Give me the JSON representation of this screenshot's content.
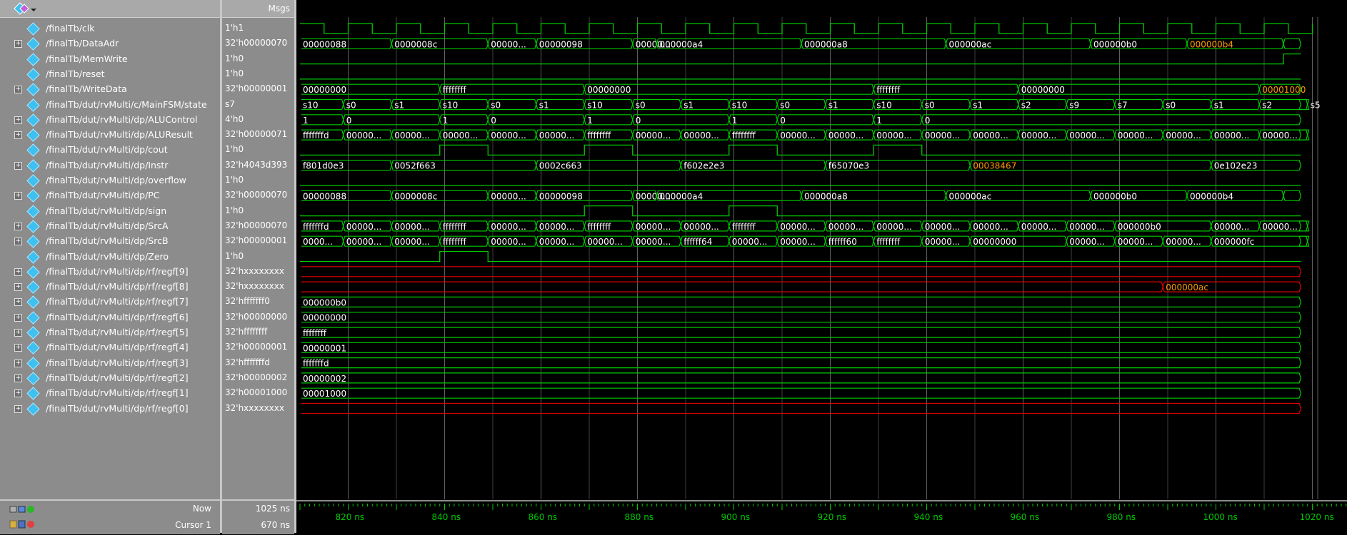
{
  "header": {
    "msgs_label": "Msgs"
  },
  "colors": {
    "wave": "#00c800",
    "invalid": "#e00000",
    "cursor": "#e0c000",
    "text_highlight": "#ff9900"
  },
  "signals": [
    {
      "name": "/finalTb/clk",
      "value": "1'h1",
      "expand": false
    },
    {
      "name": "/finalTb/DataAdr",
      "value": "32'h00000070",
      "expand": true
    },
    {
      "name": "/finalTb/MemWrite",
      "value": "1'h0",
      "expand": false
    },
    {
      "name": "/finalTb/reset",
      "value": "1'h0",
      "expand": false
    },
    {
      "name": "/finalTb/WriteData",
      "value": "32'h00000001",
      "expand": true
    },
    {
      "name": "/finalTb/dut/rvMulti/c/MainFSM/state",
      "value": "s7",
      "expand": false
    },
    {
      "name": "/finalTb/dut/rvMulti/dp/ALUControl",
      "value": "4'h0",
      "expand": true
    },
    {
      "name": "/finalTb/dut/rvMulti/dp/ALUResult",
      "value": "32'h00000071",
      "expand": true
    },
    {
      "name": "/finalTb/dut/rvMulti/dp/cout",
      "value": "1'h0",
      "expand": false
    },
    {
      "name": "/finalTb/dut/rvMulti/dp/Instr",
      "value": "32'h4043d393",
      "expand": true
    },
    {
      "name": "/finalTb/dut/rvMulti/dp/overflow",
      "value": "1'h0",
      "expand": false
    },
    {
      "name": "/finalTb/dut/rvMulti/dp/PC",
      "value": "32'h00000070",
      "expand": true
    },
    {
      "name": "/finalTb/dut/rvMulti/dp/sign",
      "value": "1'h0",
      "expand": false
    },
    {
      "name": "/finalTb/dut/rvMulti/dp/SrcA",
      "value": "32'h00000070",
      "expand": true
    },
    {
      "name": "/finalTb/dut/rvMulti/dp/SrcB",
      "value": "32'h00000001",
      "expand": true
    },
    {
      "name": "/finalTb/dut/rvMulti/dp/Zero",
      "value": "1'h0",
      "expand": false
    },
    {
      "name": "/finalTb/dut/rvMulti/dp/rf/regf[9]",
      "value": "32'hxxxxxxxx",
      "expand": true
    },
    {
      "name": "/finalTb/dut/rvMulti/dp/rf/regf[8]",
      "value": "32'hxxxxxxxx",
      "expand": true
    },
    {
      "name": "/finalTb/dut/rvMulti/dp/rf/regf[7]",
      "value": "32'hfffffff0",
      "expand": true
    },
    {
      "name": "/finalTb/dut/rvMulti/dp/rf/regf[6]",
      "value": "32'h00000000",
      "expand": true
    },
    {
      "name": "/finalTb/dut/rvMulti/dp/rf/regf[5]",
      "value": "32'hffffffff",
      "expand": true
    },
    {
      "name": "/finalTb/dut/rvMulti/dp/rf/regf[4]",
      "value": "32'h00000001",
      "expand": true
    },
    {
      "name": "/finalTb/dut/rvMulti/dp/rf/regf[3]",
      "value": "32'hfffffffd",
      "expand": true
    },
    {
      "name": "/finalTb/dut/rvMulti/dp/rf/regf[2]",
      "value": "32'h00000002",
      "expand": true
    },
    {
      "name": "/finalTb/dut/rvMulti/dp/rf/regf[1]",
      "value": "32'h00001000",
      "expand": true
    },
    {
      "name": "/finalTb/dut/rvMulti/dp/rf/regf[0]",
      "value": "32'hxxxxxxxx",
      "expand": true
    }
  ],
  "waves": {
    "t0": 810,
    "t_end": 1025,
    "rows": [
      {
        "kind": "clk",
        "high_first": true
      },
      {
        "kind": "bus",
        "segs": [
          [
            810,
            "00000088"
          ],
          [
            829,
            "0000008c"
          ],
          [
            849,
            "00000..."
          ],
          [
            859,
            "00000098"
          ],
          [
            879,
            "00000..."
          ],
          [
            884,
            "000000a4"
          ],
          [
            914,
            "000000a8"
          ],
          [
            944,
            "000000ac"
          ],
          [
            974,
            "000000b0"
          ],
          [
            994,
            "000000b4",
            1
          ],
          [
            1014,
            ""
          ]
        ]
      },
      {
        "kind": "bit",
        "segs": [
          [
            810,
            0
          ],
          [
            1014,
            1
          ]
        ]
      },
      {
        "kind": "bit",
        "segs": [
          [
            810,
            0
          ]
        ]
      },
      {
        "kind": "bus",
        "segs": [
          [
            810,
            "00000000"
          ],
          [
            839,
            "ffffffff"
          ],
          [
            869,
            "00000000"
          ],
          [
            929,
            "ffffffff"
          ],
          [
            959,
            "00000000"
          ],
          [
            1009,
            "00001000",
            1
          ]
        ]
      },
      {
        "kind": "bus",
        "segs": [
          [
            810,
            "s10"
          ],
          [
            819,
            "s0"
          ],
          [
            829,
            "s1"
          ],
          [
            839,
            "s10"
          ],
          [
            849,
            "s0"
          ],
          [
            859,
            "s1"
          ],
          [
            869,
            "s10"
          ],
          [
            879,
            "s0"
          ],
          [
            889,
            "s1"
          ],
          [
            899,
            "s10"
          ],
          [
            909,
            "s0"
          ],
          [
            919,
            "s1"
          ],
          [
            929,
            "s10"
          ],
          [
            939,
            "s0"
          ],
          [
            949,
            "s1"
          ],
          [
            959,
            "s2"
          ],
          [
            969,
            "s9"
          ],
          [
            979,
            "s7"
          ],
          [
            989,
            "s0"
          ],
          [
            999,
            "s1"
          ],
          [
            1009,
            "s2"
          ],
          [
            1019,
            "s5"
          ]
        ]
      },
      {
        "kind": "bus",
        "segs": [
          [
            810,
            "1"
          ],
          [
            819,
            "0"
          ],
          [
            839,
            "1"
          ],
          [
            849,
            "0"
          ],
          [
            869,
            "1"
          ],
          [
            879,
            "0"
          ],
          [
            899,
            "1"
          ],
          [
            909,
            "0"
          ],
          [
            929,
            "1"
          ],
          [
            939,
            "0"
          ]
        ]
      },
      {
        "kind": "bus",
        "segs": [
          [
            810,
            "fffffffd"
          ],
          [
            819,
            "00000..."
          ],
          [
            829,
            "00000..."
          ],
          [
            839,
            "00000..."
          ],
          [
            849,
            "00000..."
          ],
          [
            859,
            "00000..."
          ],
          [
            869,
            "ffffffff"
          ],
          [
            879,
            "00000..."
          ],
          [
            889,
            "00000..."
          ],
          [
            899,
            "ffffffff"
          ],
          [
            909,
            "00000..."
          ],
          [
            919,
            "00000..."
          ],
          [
            929,
            "00000..."
          ],
          [
            939,
            "00000..."
          ],
          [
            949,
            "00000..."
          ],
          [
            959,
            "00000..."
          ],
          [
            969,
            "00000..."
          ],
          [
            979,
            "00000..."
          ],
          [
            989,
            "00000..."
          ],
          [
            999,
            "00000..."
          ],
          [
            1009,
            "00000..."
          ],
          [
            1019,
            ""
          ]
        ]
      },
      {
        "kind": "bit",
        "segs": [
          [
            810,
            0
          ],
          [
            839,
            1
          ],
          [
            849,
            0
          ],
          [
            869,
            1
          ],
          [
            879,
            0
          ],
          [
            899,
            1
          ],
          [
            909,
            0
          ],
          [
            929,
            1
          ],
          [
            939,
            0
          ]
        ]
      },
      {
        "kind": "bus",
        "segs": [
          [
            810,
            "f801d0e3"
          ],
          [
            829,
            "0052f663"
          ],
          [
            859,
            "0002c663"
          ],
          [
            889,
            "f602e2e3"
          ],
          [
            919,
            "f65070e3"
          ],
          [
            949,
            "00038467",
            1
          ],
          [
            999,
            "0e102e23"
          ]
        ]
      },
      {
        "kind": "bit",
        "segs": [
          [
            810,
            0
          ]
        ]
      },
      {
        "kind": "bus",
        "segs": [
          [
            810,
            "00000088"
          ],
          [
            829,
            "0000008c"
          ],
          [
            849,
            "00000..."
          ],
          [
            859,
            "00000098"
          ],
          [
            879,
            "00000..."
          ],
          [
            884,
            "000000a4"
          ],
          [
            914,
            "000000a8"
          ],
          [
            944,
            "000000ac"
          ],
          [
            974,
            "000000b0"
          ],
          [
            994,
            "000000b4"
          ],
          [
            1014,
            ""
          ]
        ]
      },
      {
        "kind": "bit",
        "segs": [
          [
            810,
            0
          ],
          [
            869,
            1
          ],
          [
            879,
            0
          ],
          [
            899,
            1
          ],
          [
            909,
            0
          ]
        ]
      },
      {
        "kind": "bus",
        "segs": [
          [
            810,
            "fffffffd"
          ],
          [
            819,
            "00000..."
          ],
          [
            829,
            "00000..."
          ],
          [
            839,
            "ffffffff"
          ],
          [
            849,
            "00000..."
          ],
          [
            859,
            "00000..."
          ],
          [
            869,
            "ffffffff"
          ],
          [
            879,
            "00000..."
          ],
          [
            889,
            "00000..."
          ],
          [
            899,
            "ffffffff"
          ],
          [
            909,
            "00000..."
          ],
          [
            919,
            "00000..."
          ],
          [
            929,
            "00000..."
          ],
          [
            939,
            "00000..."
          ],
          [
            949,
            "00000..."
          ],
          [
            959,
            "00000..."
          ],
          [
            969,
            "00000..."
          ],
          [
            979,
            "000000b0"
          ],
          [
            999,
            "00000..."
          ],
          [
            1009,
            "00000..."
          ],
          [
            1019,
            ""
          ]
        ]
      },
      {
        "kind": "bus",
        "segs": [
          [
            810,
            "0000..."
          ],
          [
            819,
            "00000..."
          ],
          [
            829,
            "00000..."
          ],
          [
            839,
            "ffffffff"
          ],
          [
            849,
            "00000..."
          ],
          [
            859,
            "00000..."
          ],
          [
            869,
            "00000..."
          ],
          [
            879,
            "00000..."
          ],
          [
            889,
            "ffffff64"
          ],
          [
            899,
            "00000..."
          ],
          [
            909,
            "00000..."
          ],
          [
            919,
            "ffffff60"
          ],
          [
            929,
            "ffffffff"
          ],
          [
            939,
            "00000..."
          ],
          [
            949,
            "00000000"
          ],
          [
            969,
            "00000..."
          ],
          [
            979,
            "00000..."
          ],
          [
            989,
            "00000..."
          ],
          [
            999,
            "000000fc"
          ],
          [
            1019,
            ""
          ]
        ]
      },
      {
        "kind": "bit",
        "segs": [
          [
            810,
            0
          ],
          [
            839,
            1
          ],
          [
            849,
            0
          ]
        ]
      },
      {
        "kind": "xbus",
        "segs": [
          [
            810,
            ""
          ]
        ]
      },
      {
        "kind": "xbus",
        "segs": [
          [
            810,
            ""
          ],
          [
            989,
            "000000ac",
            1
          ]
        ]
      },
      {
        "kind": "bus",
        "segs": [
          [
            810,
            "000000b0"
          ]
        ]
      },
      {
        "kind": "bus",
        "segs": [
          [
            810,
            "00000000"
          ]
        ]
      },
      {
        "kind": "bus",
        "segs": [
          [
            810,
            "ffffffff"
          ]
        ]
      },
      {
        "kind": "bus",
        "segs": [
          [
            810,
            "00000001"
          ]
        ]
      },
      {
        "kind": "bus",
        "segs": [
          [
            810,
            "fffffffd"
          ]
        ]
      },
      {
        "kind": "bus",
        "segs": [
          [
            810,
            "00000002"
          ]
        ]
      },
      {
        "kind": "bus",
        "segs": [
          [
            810,
            "00001000"
          ]
        ]
      },
      {
        "kind": "xbus",
        "segs": [
          [
            810,
            ""
          ]
        ]
      }
    ],
    "ticks": [
      {
        "t": 820,
        "label": "820 ns"
      },
      {
        "t": 840,
        "label": "840 ns"
      },
      {
        "t": 860,
        "label": "860 ns"
      },
      {
        "t": 880,
        "label": "880 ns"
      },
      {
        "t": 900,
        "label": "900 ns"
      },
      {
        "t": 920,
        "label": "920 ns"
      },
      {
        "t": 940,
        "label": "940 ns"
      },
      {
        "t": 960,
        "label": "960 ns"
      },
      {
        "t": 980,
        "label": "980 ns"
      },
      {
        "t": 1000,
        "label": "1000 ns"
      },
      {
        "t": 1020,
        "label": "1020 ns"
      }
    ]
  },
  "bottom": {
    "now_label": "Now",
    "now_value": "1025 ns",
    "cursor_label": "Cursor 1",
    "cursor_value": "670 ns"
  }
}
